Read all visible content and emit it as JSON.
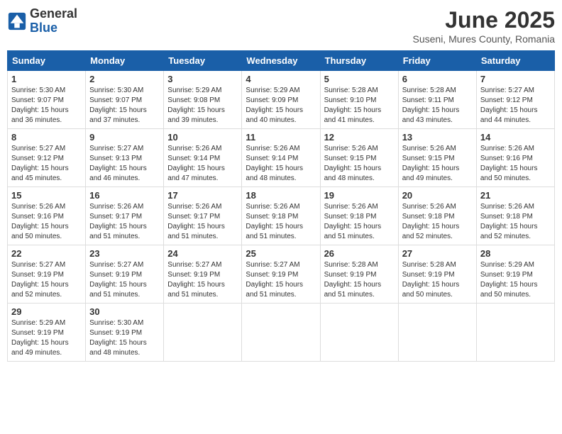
{
  "header": {
    "logo_general": "General",
    "logo_blue": "Blue",
    "month_title": "June 2025",
    "location": "Suseni, Mures County, Romania"
  },
  "days_of_week": [
    "Sunday",
    "Monday",
    "Tuesday",
    "Wednesday",
    "Thursday",
    "Friday",
    "Saturday"
  ],
  "weeks": [
    [
      {
        "day": "1",
        "text": "Sunrise: 5:30 AM\nSunset: 9:07 PM\nDaylight: 15 hours\nand 36 minutes."
      },
      {
        "day": "2",
        "text": "Sunrise: 5:30 AM\nSunset: 9:07 PM\nDaylight: 15 hours\nand 37 minutes."
      },
      {
        "day": "3",
        "text": "Sunrise: 5:29 AM\nSunset: 9:08 PM\nDaylight: 15 hours\nand 39 minutes."
      },
      {
        "day": "4",
        "text": "Sunrise: 5:29 AM\nSunset: 9:09 PM\nDaylight: 15 hours\nand 40 minutes."
      },
      {
        "day": "5",
        "text": "Sunrise: 5:28 AM\nSunset: 9:10 PM\nDaylight: 15 hours\nand 41 minutes."
      },
      {
        "day": "6",
        "text": "Sunrise: 5:28 AM\nSunset: 9:11 PM\nDaylight: 15 hours\nand 43 minutes."
      },
      {
        "day": "7",
        "text": "Sunrise: 5:27 AM\nSunset: 9:12 PM\nDaylight: 15 hours\nand 44 minutes."
      }
    ],
    [
      {
        "day": "8",
        "text": "Sunrise: 5:27 AM\nSunset: 9:12 PM\nDaylight: 15 hours\nand 45 minutes."
      },
      {
        "day": "9",
        "text": "Sunrise: 5:27 AM\nSunset: 9:13 PM\nDaylight: 15 hours\nand 46 minutes."
      },
      {
        "day": "10",
        "text": "Sunrise: 5:26 AM\nSunset: 9:14 PM\nDaylight: 15 hours\nand 47 minutes."
      },
      {
        "day": "11",
        "text": "Sunrise: 5:26 AM\nSunset: 9:14 PM\nDaylight: 15 hours\nand 48 minutes."
      },
      {
        "day": "12",
        "text": "Sunrise: 5:26 AM\nSunset: 9:15 PM\nDaylight: 15 hours\nand 48 minutes."
      },
      {
        "day": "13",
        "text": "Sunrise: 5:26 AM\nSunset: 9:15 PM\nDaylight: 15 hours\nand 49 minutes."
      },
      {
        "day": "14",
        "text": "Sunrise: 5:26 AM\nSunset: 9:16 PM\nDaylight: 15 hours\nand 50 minutes."
      }
    ],
    [
      {
        "day": "15",
        "text": "Sunrise: 5:26 AM\nSunset: 9:16 PM\nDaylight: 15 hours\nand 50 minutes."
      },
      {
        "day": "16",
        "text": "Sunrise: 5:26 AM\nSunset: 9:17 PM\nDaylight: 15 hours\nand 51 minutes."
      },
      {
        "day": "17",
        "text": "Sunrise: 5:26 AM\nSunset: 9:17 PM\nDaylight: 15 hours\nand 51 minutes."
      },
      {
        "day": "18",
        "text": "Sunrise: 5:26 AM\nSunset: 9:18 PM\nDaylight: 15 hours\nand 51 minutes."
      },
      {
        "day": "19",
        "text": "Sunrise: 5:26 AM\nSunset: 9:18 PM\nDaylight: 15 hours\nand 51 minutes."
      },
      {
        "day": "20",
        "text": "Sunrise: 5:26 AM\nSunset: 9:18 PM\nDaylight: 15 hours\nand 52 minutes."
      },
      {
        "day": "21",
        "text": "Sunrise: 5:26 AM\nSunset: 9:18 PM\nDaylight: 15 hours\nand 52 minutes."
      }
    ],
    [
      {
        "day": "22",
        "text": "Sunrise: 5:27 AM\nSunset: 9:19 PM\nDaylight: 15 hours\nand 52 minutes."
      },
      {
        "day": "23",
        "text": "Sunrise: 5:27 AM\nSunset: 9:19 PM\nDaylight: 15 hours\nand 51 minutes."
      },
      {
        "day": "24",
        "text": "Sunrise: 5:27 AM\nSunset: 9:19 PM\nDaylight: 15 hours\nand 51 minutes."
      },
      {
        "day": "25",
        "text": "Sunrise: 5:27 AM\nSunset: 9:19 PM\nDaylight: 15 hours\nand 51 minutes."
      },
      {
        "day": "26",
        "text": "Sunrise: 5:28 AM\nSunset: 9:19 PM\nDaylight: 15 hours\nand 51 minutes."
      },
      {
        "day": "27",
        "text": "Sunrise: 5:28 AM\nSunset: 9:19 PM\nDaylight: 15 hours\nand 50 minutes."
      },
      {
        "day": "28",
        "text": "Sunrise: 5:29 AM\nSunset: 9:19 PM\nDaylight: 15 hours\nand 50 minutes."
      }
    ],
    [
      {
        "day": "29",
        "text": "Sunrise: 5:29 AM\nSunset: 9:19 PM\nDaylight: 15 hours\nand 49 minutes."
      },
      {
        "day": "30",
        "text": "Sunrise: 5:30 AM\nSunset: 9:19 PM\nDaylight: 15 hours\nand 48 minutes."
      },
      {
        "day": "",
        "text": ""
      },
      {
        "day": "",
        "text": ""
      },
      {
        "day": "",
        "text": ""
      },
      {
        "day": "",
        "text": ""
      },
      {
        "day": "",
        "text": ""
      }
    ]
  ]
}
